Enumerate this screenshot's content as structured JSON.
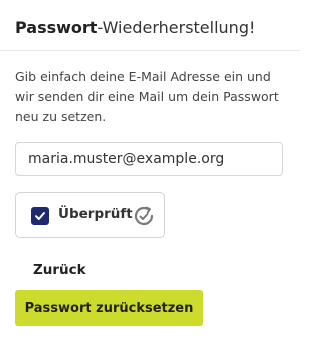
{
  "header": {
    "title_strong": "Passwort",
    "title_light": "-Wiederherstellung!"
  },
  "description": "Gib einfach deine E-Mail Adresse ein und wir senden dir eine Mail um dein Passwort neu zu setzen.",
  "email_field": {
    "value": "maria.muster@example.org"
  },
  "captcha": {
    "checked": true,
    "label": "Überprüft",
    "logo_icon": "captcha-logo-icon",
    "check_icon": "checkmark-icon"
  },
  "actions": {
    "back_label": "Zurück",
    "submit_label": "Passwort zurücksetzen"
  },
  "colors": {
    "accent": "#cddc2c",
    "checkbox": "#1f2a6e",
    "text": "#222222"
  }
}
